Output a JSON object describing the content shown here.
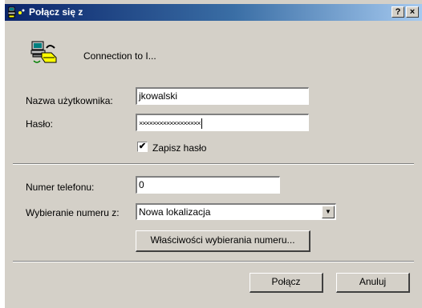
{
  "window": {
    "title": "Połącz się z",
    "icons": {
      "title": "network-connection-icon",
      "header": "dialup-computer-icon"
    },
    "help_button": "?",
    "close_button": "×"
  },
  "header": {
    "connection_name": "Connection to I..."
  },
  "form": {
    "username": {
      "label": "Nazwa użytkownika:",
      "value": "jkowalski"
    },
    "password": {
      "label": "Hasło:",
      "value": "××××××××××××××××××"
    },
    "save_password": {
      "label": "Zapisz hasło",
      "checked": true,
      "mark": "✔"
    },
    "phone": {
      "label": "Numer telefonu:",
      "value": "0"
    },
    "dial_from": {
      "label": "Wybieranie numeru z:",
      "value": "Nowa lokalizacja"
    },
    "dialing_properties_button": "Właściwości wybierania numeru..."
  },
  "buttons": {
    "connect": "Połącz",
    "cancel": "Anuluj"
  }
}
